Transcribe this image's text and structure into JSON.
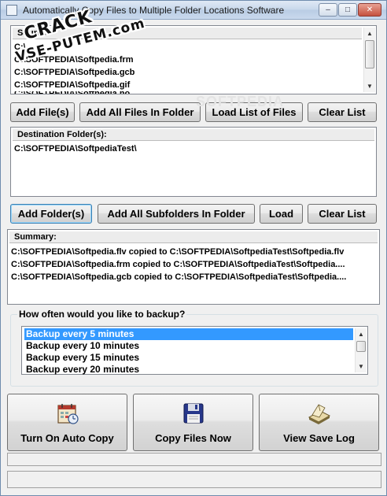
{
  "window": {
    "title": "Automatically Copy Files to Multiple Folder Locations Software",
    "controls": {
      "minimize": "–",
      "maximize": "□",
      "close": "✕"
    }
  },
  "source": {
    "header": "Source",
    "files": [
      "C:\\SOFTPEDIA\\Softpedia.flv",
      "C:\\SOFTPEDIA\\Softpedia.frm",
      "C:\\SOFTPEDIA\\Softpedia.gcb",
      "C:\\SOFTPEDIA\\Softpedia.gif",
      "C:\\SOFTPEDIA\\Softpedia.ho"
    ],
    "visible": [
      "C:\\",
      "C:\\SOFTPEDIA\\Softpedia.frm",
      "C:\\SOFTPEDIA\\Softpedia.gcb",
      "C:\\SOFTPEDIA\\Softpedia.gif",
      "C:\\SOFTPEDIA\\Softpedia.ho"
    ]
  },
  "source_buttons": {
    "add_files": "Add File(s)",
    "add_all_in_folder": "Add All Files In Folder",
    "load_list": "Load List of Files",
    "clear_list": "Clear List"
  },
  "destination": {
    "header": "Destination Folder(s):",
    "folders": [
      "C:\\SOFTPEDIA\\SoftpediaTest\\"
    ]
  },
  "destination_buttons": {
    "add_folders": "Add Folder(s)",
    "add_all_subfolders": "Add All Subfolders In Folder",
    "load": "Load",
    "clear_list": "Clear List"
  },
  "summary": {
    "header": "Summary:",
    "lines": [
      "C:\\SOFTPEDIA\\Softpedia.flv copied to C:\\SOFTPEDIA\\SoftpediaTest\\Softpedia.flv",
      "C:\\SOFTPEDIA\\Softpedia.frm copied to C:\\SOFTPEDIA\\SoftpediaTest\\Softpedia....",
      "C:\\SOFTPEDIA\\Softpedia.gcb copied to C:\\SOFTPEDIA\\SoftpediaTest\\Softpedia...."
    ]
  },
  "backup": {
    "label": "How often would you like to backup?",
    "options": [
      "Backup every 5 minutes",
      "Backup every 10 minutes",
      "Backup every 15 minutes",
      "Backup every 20 minutes"
    ],
    "selected": "Backup every 5 minutes"
  },
  "actions": {
    "auto_copy": {
      "label": "Turn On Auto Copy",
      "icon": "calendar-clock-icon"
    },
    "copy_now": {
      "label": "Copy Files Now",
      "icon": "floppy-disk-icon"
    },
    "view_log": {
      "label": "View Save Log",
      "icon": "open-book-icon"
    }
  },
  "watermark": {
    "line1": "CRACK",
    "line2": "VSE-PUTEM.com"
  },
  "background_watermark": "SOFTPEDIA",
  "colors": {
    "selection": "#3399ff",
    "window_bg": "#f0f0f0",
    "title_gradient": "#c7d7ea"
  }
}
